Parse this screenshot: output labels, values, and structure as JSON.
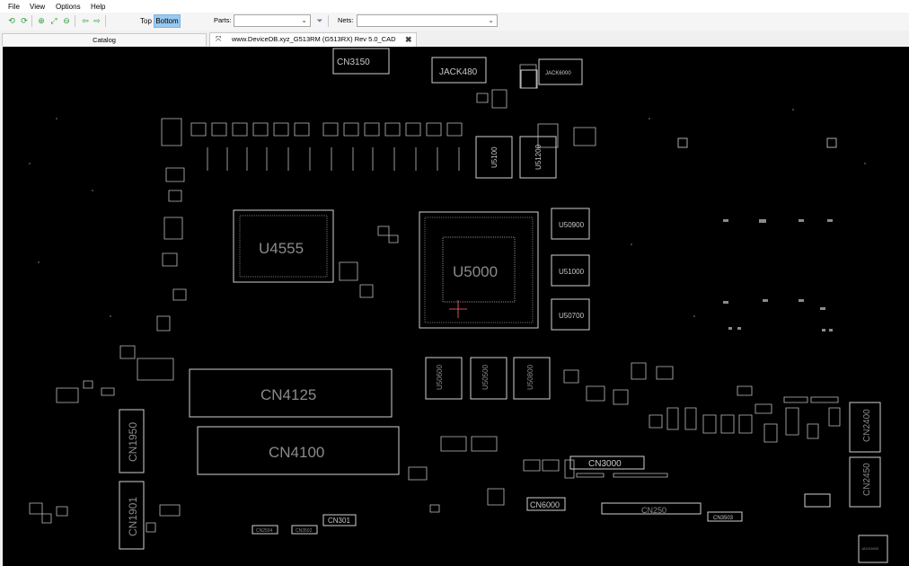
{
  "menu": {
    "file": "File",
    "view": "View",
    "options": "Options",
    "help": "Help"
  },
  "toolbar": {
    "icons": [
      "rotate-left-icon",
      "rotate-right-icon",
      "zoom-in-icon",
      "zoom-fit-icon",
      "zoom-out-icon",
      "back-arrow-icon",
      "forward-arrow-icon"
    ],
    "top_label": "Top",
    "bottom_label": "Bottom",
    "parts_label": "Parts:",
    "parts_value": "",
    "nets_label": "Nets:",
    "nets_value": ""
  },
  "tabs": {
    "catalog": "Catalog",
    "document": "www.DeviceDB.xyz_G513RM (G513RX) Rev 5.0_CAD"
  },
  "components": {
    "cn3150": "CN3150",
    "jack480": "JACK480",
    "jack6000": "JACK6000",
    "u4555": "U4555",
    "u5000": "U5000",
    "u5100": "U5100",
    "u51200": "U51200",
    "u50900": "U50900",
    "u51000": "U51000",
    "u50700": "U50700",
    "u50600": "U50600",
    "u50500": "U50500",
    "u50800": "U50800",
    "cn4125": "CN4125",
    "cn4100": "CN4100",
    "cn1950": "CN1950",
    "cn1901": "CN1901",
    "cn3000": "CN3000",
    "cn6000": "CN6000",
    "cn250": "CN250",
    "cn301": "CN301",
    "cn2504": "CN2504",
    "cn3502": "CN3502",
    "cn3503": "CN3503",
    "cn2400": "CN2400",
    "cn2450": "CN2450",
    "jack5000": "JACK5000"
  }
}
